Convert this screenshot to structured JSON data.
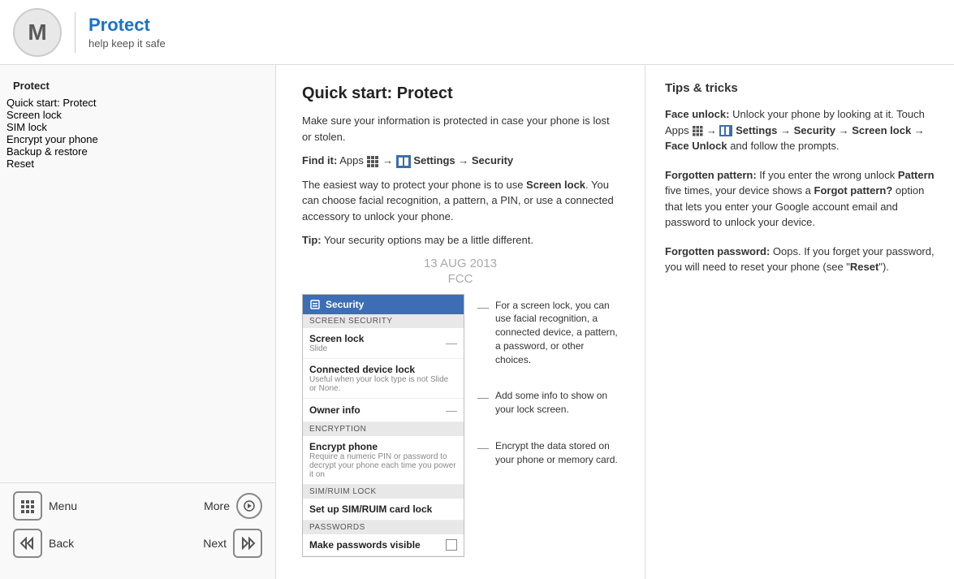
{
  "header": {
    "logo_letter": "M",
    "title": "Protect",
    "subtitle": "help keep it safe"
  },
  "sidebar": {
    "nav_title": "Protect",
    "nav_items": [
      {
        "label": "Quick start: Protect",
        "active": true
      },
      {
        "label": "Screen lock",
        "active": false
      },
      {
        "label": "SIM lock",
        "active": false
      },
      {
        "label": "Encrypt your phone",
        "active": false
      },
      {
        "label": "Backup & restore",
        "active": false
      },
      {
        "label": "Reset",
        "active": false
      }
    ],
    "bottom": {
      "menu_label": "Menu",
      "more_label": "More",
      "back_label": "Back",
      "next_label": "Next"
    }
  },
  "center": {
    "title": "Quick start: Protect",
    "intro": "Make sure your information is protected in case your phone is lost or stolen.",
    "find_it_prefix": "Find it:",
    "find_it_text": " Apps  →  Settings → Security",
    "body_text": "The easiest way to protect your phone is to use Screen lock. You can choose facial recognition, a pattern, a PIN, or use a connected accessory to unlock your phone.",
    "tip_prefix": "Tip:",
    "tip_text": " Your security options may be a little different.",
    "watermark_date": "13 AUG 2013",
    "watermark_fcc": "FCC",
    "phone": {
      "header_title": "Security",
      "sections": [
        {
          "header": "SCREEN SECURITY",
          "items": [
            {
              "main": "Screen lock",
              "sub": "Slide",
              "has_arrow": true
            },
            {
              "main": "Connected device lock",
              "sub": "Useful when your lock type is not Slide or None.",
              "has_arrow": false
            }
          ]
        },
        {
          "header": "",
          "items": [
            {
              "main": "Owner info",
              "sub": "",
              "has_arrow": true
            }
          ]
        },
        {
          "header": "ENCRYPTION",
          "items": [
            {
              "main": "Encrypt phone",
              "sub": "Require a numeric PIN or password to decrypt your phone each time you power it on",
              "has_arrow": false
            }
          ]
        },
        {
          "header": "SIM/RUIM LOCK",
          "items": [
            {
              "main": "Set up SIM/RUIM card lock",
              "sub": "",
              "has_arrow": false
            }
          ]
        },
        {
          "header": "PASSWORDS",
          "items": [
            {
              "main": "Make passwords visible",
              "sub": "",
              "has_checkbox": true
            }
          ]
        }
      ]
    },
    "callouts": [
      "For a screen lock, you can use facial recognition, a connected device, a pattern, a password, or other choices.",
      "Add some info to show on your lock screen.",
      "Encrypt the data stored on your phone or memory card."
    ]
  },
  "tips": {
    "title": "Tips & tricks",
    "items": [
      {
        "title": "Face unlock:",
        "text": " Unlock your phone by looking at it. Touch Apps  →  Settings → Security → Screen lock → Face Unlock and follow the prompts."
      },
      {
        "title": "Forgotten pattern:",
        "text": " If you enter the wrong unlock Pattern five times, your device shows a Forgot pattern? option that lets you enter your Google account email and password to unlock your device."
      },
      {
        "title": "Forgotten password:",
        "text": " Oops. If you forget your password, you will need to reset your phone (see \"Reset\")."
      }
    ]
  }
}
